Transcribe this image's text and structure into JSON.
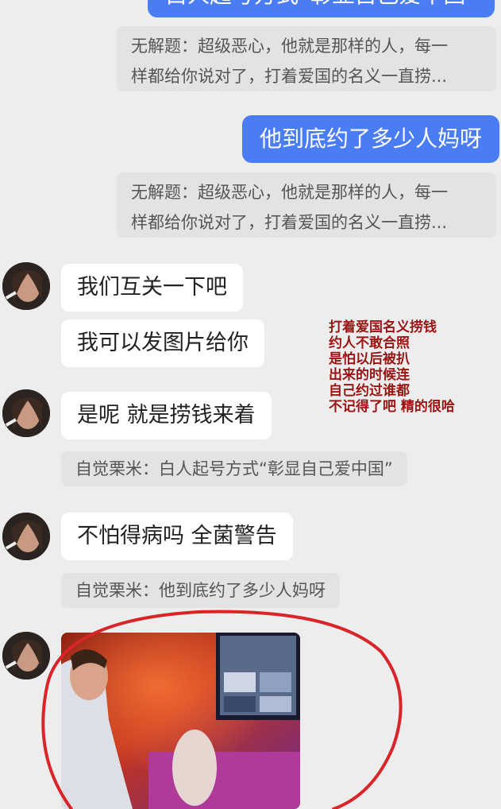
{
  "messages": {
    "top_sent_partial": "白人起号方式“彰显自己爱中国”",
    "quote_1": {
      "line1": "无解题：超级恶心，他就是那样的人，每一",
      "line2": "样都给你说对了，打着爱国的名义一直捞..."
    },
    "sent_2": "他到底约了多少人妈呀",
    "quote_2": {
      "line1": "无解题：超级恶心，他就是那样的人，每一",
      "line2": "样都给你说对了，打着爱国的名义一直捞..."
    },
    "recv_1": "我们互关一下吧",
    "recv_2": "我可以发图片给你",
    "recv_3": "是呢 就是捞钱来着",
    "quote_3": "自觉栗米：白人起号方式“彰显自己爱中国”",
    "recv_4": "不怕得病吗 全菌警告",
    "quote_4": "自觉栗米：他到底约了多少人妈呀"
  },
  "annotation": {
    "lines": [
      "打着爱国名义捞钱",
      "约人不敢合照",
      "是怕以后被扒",
      "出来的时候连",
      "自己约过谁都",
      "不记得了吧 精的很哈"
    ],
    "color": "#9a1414"
  },
  "colors": {
    "sent_bubble": "#4a7cf3",
    "background": "#ededed",
    "circle_mark": "#d9252a"
  }
}
